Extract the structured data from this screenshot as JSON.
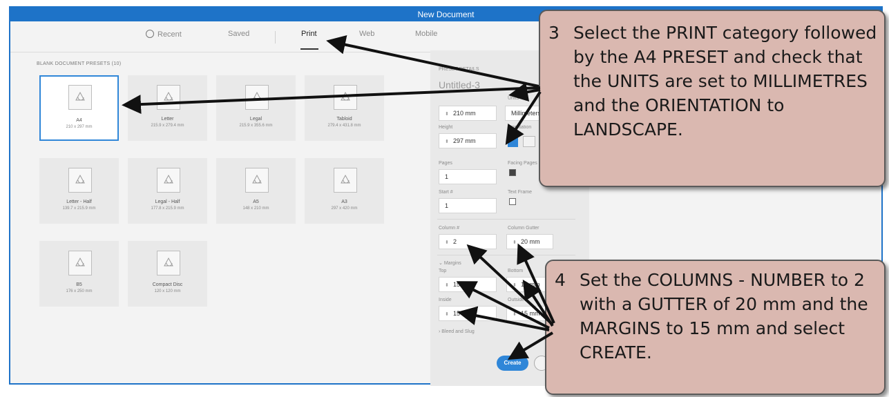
{
  "window": {
    "title": "New Document"
  },
  "tabs": [
    {
      "label": "Recent"
    },
    {
      "label": "Saved"
    },
    {
      "label": "Print"
    },
    {
      "label": "Web"
    },
    {
      "label": "Mobile"
    }
  ],
  "presets_section": {
    "label": "BLANK DOCUMENT PRESETS  (10)"
  },
  "presets": [
    {
      "name": "A4",
      "size": "210 x 297 mm"
    },
    {
      "name": "Letter",
      "size": "215.9 x 279.4 mm"
    },
    {
      "name": "Legal",
      "size": "215.9 x 355.6 mm"
    },
    {
      "name": "Tabloid",
      "size": "279.4 x 431.8 mm"
    },
    {
      "name": "Letter - Half",
      "size": "139.7 x 215.9 mm"
    },
    {
      "name": "Legal - Half",
      "size": "177.8 x 215.9 mm"
    },
    {
      "name": "A5",
      "size": "148 x 210 mm"
    },
    {
      "name": "A3",
      "size": "297 x 420 mm"
    },
    {
      "name": "B5",
      "size": "176 x 250 mm"
    },
    {
      "name": "Compact Disc",
      "size": "120 x 120 mm"
    }
  ],
  "details": {
    "header": "PRESET DETAILS",
    "doc_name": "Untitled-3",
    "units_label": "Units",
    "width_value": "210 mm",
    "units_value": "Millimeters",
    "height_label": "Height",
    "height_value": "297 mm",
    "orientation_label": "Orientation",
    "pages_label": "Pages",
    "pages_value": "1",
    "facing_label": "Facing Pages",
    "start_label": "Start #",
    "start_value": "1",
    "textframe_label": "Text Frame",
    "columns_label": "Column #",
    "columns_value": "2",
    "gutter_label": "Column Gutter",
    "gutter_value": "20 mm",
    "margins_label": "Margins",
    "top_label": "Top",
    "top_value": "15 mm",
    "bottom_label": "Bottom",
    "bottom_value": "15 mm",
    "inside_label": "Inside",
    "inside_value": "15 mm",
    "outside_label": "Outside",
    "outside_value": "15 mm",
    "bleed_label": "Bleed and Slug",
    "create_label": "Create"
  },
  "callouts": {
    "c3": {
      "number": "3",
      "text": "Select the PRINT category followed by the A4 PRESET and check that the UNITS are set to MILLIMETRES and the ORIENTATION to LANDSCAPE."
    },
    "c4": {
      "number": "4",
      "text": "Set the COLUMNS - NUMBER to 2 with a GUTTER of 20 mm and the MARGINS to 15 mm and select CREATE."
    }
  },
  "colors": {
    "title_bar": "#1e73c8",
    "accent": "#2f86d8",
    "callout_bg": "#dab8b0"
  }
}
